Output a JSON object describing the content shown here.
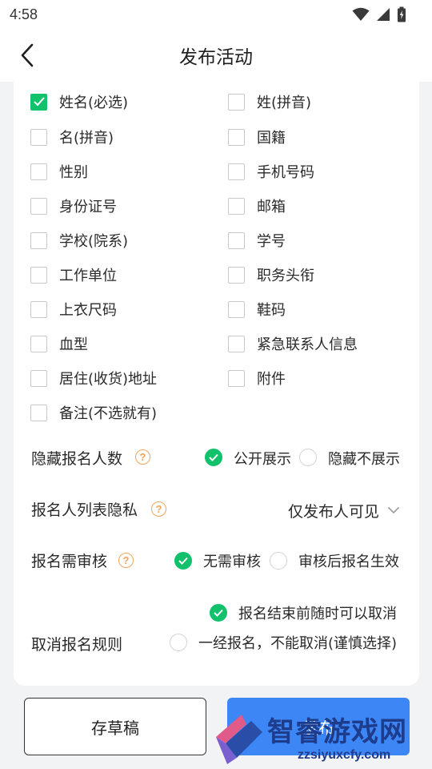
{
  "status_bar": {
    "time": "4:58",
    "icons": [
      "wifi-icon",
      "signal-icon",
      "battery-icon"
    ]
  },
  "nav": {
    "back_icon": "chevron-left-icon",
    "title": "发布活动"
  },
  "fields": [
    {
      "label": "姓名(必选)",
      "checked": true
    },
    {
      "label": "姓(拼音)",
      "checked": false
    },
    {
      "label": "名(拼音)",
      "checked": false
    },
    {
      "label": "国籍",
      "checked": false
    },
    {
      "label": "性别",
      "checked": false
    },
    {
      "label": "手机号码",
      "checked": false
    },
    {
      "label": "身份证号",
      "checked": false
    },
    {
      "label": "邮箱",
      "checked": false
    },
    {
      "label": "学校(院系)",
      "checked": false
    },
    {
      "label": "学号",
      "checked": false
    },
    {
      "label": "工作单位",
      "checked": false
    },
    {
      "label": "职务头衔",
      "checked": false
    },
    {
      "label": "上衣尺码",
      "checked": false
    },
    {
      "label": "鞋码",
      "checked": false
    },
    {
      "label": "血型",
      "checked": false
    },
    {
      "label": "紧急联系人信息",
      "checked": false
    },
    {
      "label": "居住(收货)地址",
      "checked": false
    },
    {
      "label": "附件",
      "checked": false
    },
    {
      "label": "备注(不选就有)",
      "checked": false
    }
  ],
  "settings": {
    "hide_count": {
      "label": "隐藏报名人数",
      "options": [
        {
          "label": "公开展示",
          "selected": true
        },
        {
          "label": "隐藏不展示",
          "selected": false
        }
      ]
    },
    "list_privacy": {
      "label": "报名人列表隐私",
      "value": "仅发布人可见"
    },
    "review": {
      "label": "报名需审核",
      "options": [
        {
          "label": "无需审核",
          "selected": true
        },
        {
          "label": "审核后报名生效",
          "selected": false
        }
      ]
    },
    "cancel_rule": {
      "label": "取消报名规则",
      "options": [
        {
          "label": "报名结束前随时可以取消",
          "selected": true
        },
        {
          "label": "一经报名，不能取消(谨慎选择)",
          "selected": false
        }
      ]
    }
  },
  "footer": {
    "draft_label": "存草稿",
    "publish_label": "发布"
  },
  "watermark": {
    "text": "智睿游戏网",
    "url": "zzsiyuxcfy.com"
  },
  "colors": {
    "accent_green": "#12c16b",
    "help_orange": "#f0a45a",
    "publish_blue": "#3d86f5"
  }
}
